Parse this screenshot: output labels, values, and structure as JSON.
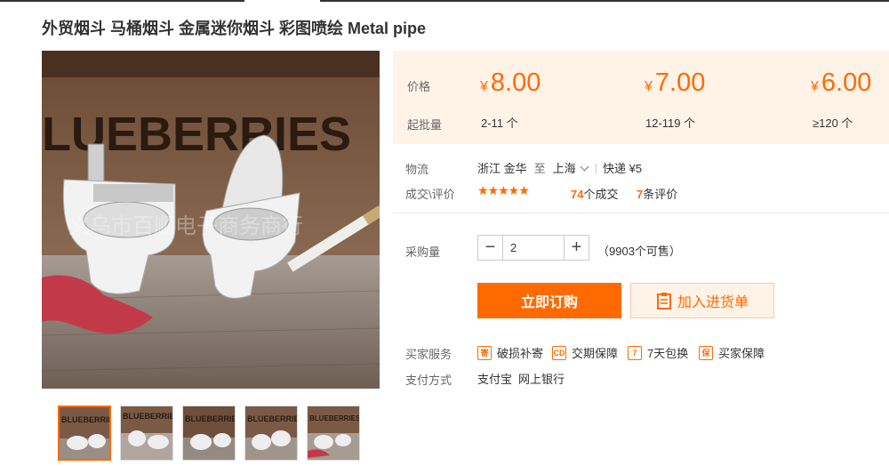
{
  "title": "外贸烟斗 马桶烟斗 金属迷你烟斗 彩图喷绘 Metal pipe",
  "photo": {
    "brand_text": "LUEBERRIES",
    "watermark": "义乌市百顺电子商务商行"
  },
  "thumbs": [
    {
      "label": "BLUEBERRIES"
    },
    {
      "label": "BLUEBERRIES"
    },
    {
      "label": "BLUEBERRIES"
    },
    {
      "label": "BLUEBERRIES"
    },
    {
      "label": "BLUEBERRIES"
    }
  ],
  "price": {
    "label": "价格",
    "batch_label": "起批量",
    "currency": "¥",
    "tiers": [
      {
        "price": "8.00",
        "range": "2-11 个"
      },
      {
        "price": "7.00",
        "range": "12-119 个"
      },
      {
        "price": "6.00",
        "range": "≥120 个"
      }
    ]
  },
  "logistics": {
    "label": "物流",
    "from": "浙江 金华",
    "to_word": "至",
    "to": "上海",
    "sep": "|",
    "express": "快递 ¥5"
  },
  "deals": {
    "label": "成交\\评价",
    "stars": "★★★★★",
    "rating": 4.5,
    "orders_num": "74",
    "orders_text": "个成交",
    "reviews_num": "7",
    "reviews_text": "条评价"
  },
  "purchase": {
    "label": "采购量",
    "minus": "−",
    "plus": "+",
    "qty": "2",
    "stock": "（9903个可售）"
  },
  "buttons": {
    "buy": "立即订购",
    "cart": "加入进货单"
  },
  "services": {
    "label": "买家服务",
    "items": [
      {
        "icon": "寄",
        "text": "破损补寄"
      },
      {
        "icon": "CD",
        "text": "交期保障"
      },
      {
        "icon": "7",
        "text": "7天包换"
      },
      {
        "icon": "保",
        "text": "买家保障"
      }
    ]
  },
  "payment": {
    "label": "支付方式",
    "methods": [
      "支付宝",
      "网上银行"
    ]
  },
  "colors": {
    "accent": "#ff6a00",
    "panel": "#fff3e8"
  }
}
